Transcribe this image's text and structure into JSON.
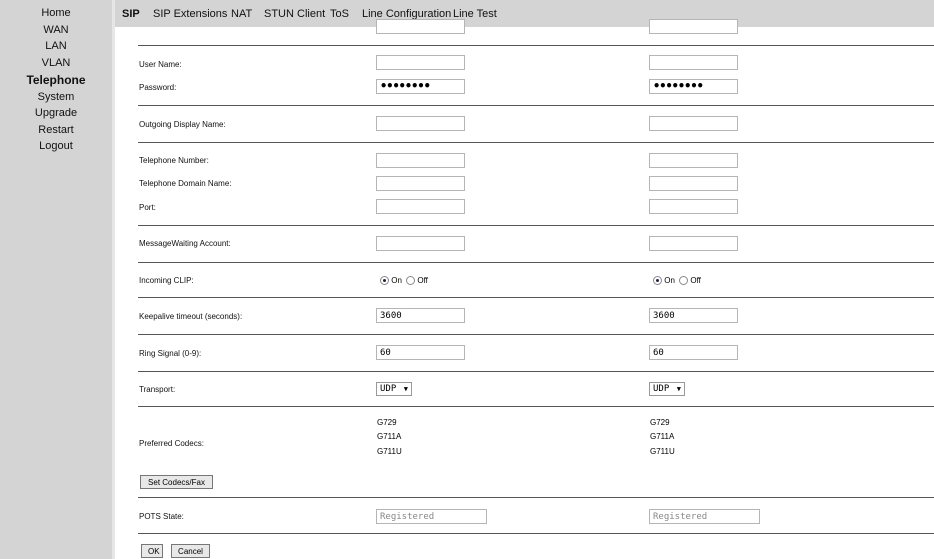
{
  "sidebar": {
    "items": [
      {
        "label": "Home",
        "active": false
      },
      {
        "label": "WAN",
        "active": false
      },
      {
        "label": "LAN",
        "active": false
      },
      {
        "label": "VLAN",
        "active": false
      },
      {
        "label": "Telephone",
        "active": true
      },
      {
        "label": "System",
        "active": false
      },
      {
        "label": "Upgrade",
        "active": false
      },
      {
        "label": "Restart",
        "active": false
      },
      {
        "label": "Logout",
        "active": false
      }
    ]
  },
  "tabs": [
    {
      "label": "SIP",
      "active": true
    },
    {
      "label": "SIP Extensions",
      "active": false
    },
    {
      "label": "NAT",
      "active": false
    },
    {
      "label": "STUN Client",
      "active": false
    },
    {
      "label": "ToS",
      "active": false
    },
    {
      "label": "Line Configuration",
      "active": false
    },
    {
      "label": "Line Test",
      "active": false
    }
  ],
  "form": {
    "user_name_label": "User Name:",
    "password_label": "Password:",
    "outgoing_display_name_label": "Outgoing Display Name:",
    "telephone_number_label": "Telephone Number:",
    "telephone_domain_name_label": "Telephone Domain Name:",
    "port_label": "Port:",
    "message_waiting_label": "MessageWaiting Account:",
    "incoming_clip_label": "Incoming CLIP:",
    "keepalive_label": "Keepalive timeout (seconds):",
    "ring_signal_label": "Ring Signal (0-9):",
    "transport_label": "Transport:",
    "preferred_codecs_label": "Preferred Codecs:",
    "pots_state_label": "POTS State:",
    "on_label": "On",
    "off_label": "Off",
    "set_codecs_button": "Set Codecs/Fax",
    "ok_button": "OK",
    "cancel_button": "Cancel"
  },
  "lines": [
    {
      "user_name": "",
      "password": "••••••••",
      "outgoing_display_name": "",
      "telephone_number": "",
      "telephone_domain_name": "",
      "port": "",
      "message_waiting": "",
      "incoming_clip": "On",
      "keepalive": "3600",
      "ring_signal": "60",
      "transport": "UDP",
      "codecs": [
        "G729",
        "G711A",
        "G711U"
      ],
      "pots_state": "Registered"
    },
    {
      "user_name": "",
      "password": "••••••••",
      "outgoing_display_name": "",
      "telephone_number": "",
      "telephone_domain_name": "",
      "port": "",
      "message_waiting": "",
      "incoming_clip": "On",
      "keepalive": "3600",
      "ring_signal": "60",
      "transport": "UDP",
      "codecs": [
        "G729",
        "G711A",
        "G711U"
      ],
      "pots_state": "Registered"
    }
  ]
}
